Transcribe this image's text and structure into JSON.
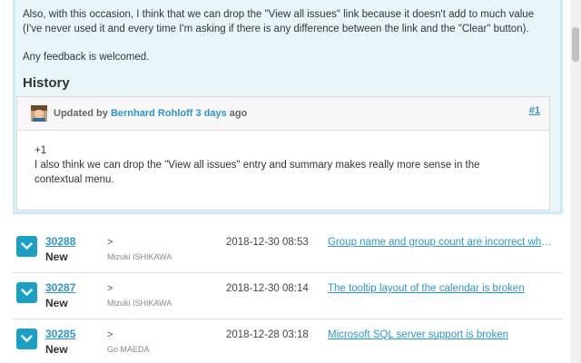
{
  "expanded_issue": {
    "paragraph1": "Also, with this occasion, I think that we can drop the \"View all issues\" link because it doesn't add to much value (I've never used it and every time I'm asking if there is any difference between the link and the \"Clear\" button).",
    "paragraph2": "Any feedback is welcomed.",
    "history_title": "History",
    "journal": {
      "updated_by_prefix": "Updated by",
      "author": "Bernhard Rohloff",
      "time_ago": "3 days",
      "time_suffix": "ago",
      "note_number": "#1",
      "body_line1": "+1",
      "body_line2": "I also think we can drop the \"View all issues\" entry and summary makes really more sense in the contextual menu."
    }
  },
  "issues": [
    {
      "id": "30288",
      "status": "New",
      "arrow": ">",
      "author": "Mizuki ISHIKAWA",
      "date": "2018-12-30 08:53",
      "subject": "Group name and group count are incorrect when grouping by..."
    },
    {
      "id": "30287",
      "status": "New",
      "arrow": ">",
      "author": "Mizuki ISHIKAWA",
      "date": "2018-12-30 08:14",
      "subject": "The tooltip layout of the calendar is broken"
    },
    {
      "id": "30285",
      "status": "New",
      "arrow": ">",
      "author": "Go MAEDA",
      "date": "2018-12-28 03:18",
      "subject": "Microsoft SQL server support is broken"
    }
  ],
  "icons": {
    "expand": "chevron-down-icon",
    "avatar": "user-avatar"
  },
  "colors": {
    "accent": "#1a9fc6",
    "link": "#2996cc",
    "expanded_bg": "#e8f6fa"
  }
}
